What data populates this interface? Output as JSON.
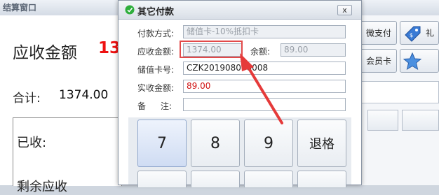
{
  "background_window": {
    "title": "结算窗口",
    "receivable_label": "应收金额",
    "receivable_value": "13",
    "total_label": "合计:",
    "total_value": "1374.00",
    "received_label": "已收:",
    "remaining_label": "剩余应收",
    "right_buttons": {
      "wechat_pay": "微支付",
      "gift": "礼",
      "member_card": "会员卡"
    }
  },
  "dialog": {
    "title": "其它付款",
    "close_label": "x",
    "fields": {
      "payment_method_label": "付款方式:",
      "payment_method_value": "储值卡-10%抵扣卡",
      "receivable_label": "应收金额:",
      "receivable_value": "1374.00",
      "balance_label": "余额:",
      "balance_value": "89.00",
      "card_no_label": "储值卡号:",
      "card_no_value": "CZK201908090008",
      "actual_label": "实收金额:",
      "actual_value": "89.00",
      "remark_label_1": "备",
      "remark_label_2": "注:",
      "remark_value": ""
    },
    "keypad": [
      "7",
      "8",
      "9",
      "退格"
    ]
  },
  "colors": {
    "accent_red": "#e11111",
    "highlight_box": "#e24a4a"
  }
}
